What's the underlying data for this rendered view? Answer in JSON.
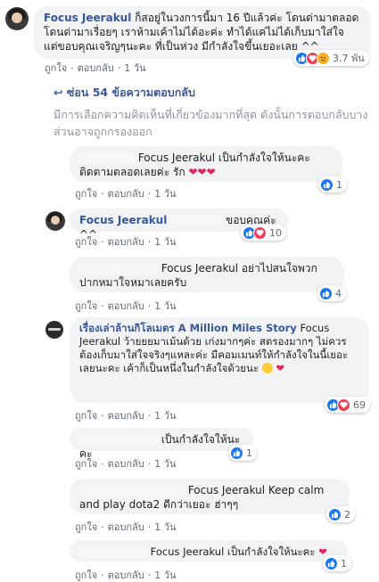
{
  "comments": [
    {
      "author": "Focus Jeerakul",
      "text": " ก็สอยู่ในวงการนี้มา 16 ปีแล้วค่ะ โดนด่ามาตลอด โดนด่ามาเรื่อยๆ เราห้ามเค้าไม่ได้อะค่ะ ทำได้แค่ไม่ได้เก็บมาใส่ใจ แต่ขอบคุณเจริญๆนะคะ ที่เป็นห่วง มีกำลังใจขึ้นเยอะเลย ^^",
      "like_label": "ถูกใจ",
      "reply_label": "ตอบกลับ",
      "time": "1 วัน",
      "reaction_count": "3.7 พัน"
    }
  ],
  "more_replies": "ซ่อน 54 ข้อความตอบกลับ",
  "relevance_notice": "มีการเลือกความคิดเห็นที่เกี่ยวข้องมากที่สุด ดังนั้นการตอบกลับบางส่วนอาจถูกกรองออก",
  "replies": [
    {
      "text": "Focus Jeerakul เป็นกำลังใจให้นะคะ ติดตามตลอดเลยค่ะ รัก",
      "like_label": "ถูกใจ",
      "reply_label": "ตอบกลับ",
      "time": "1 วัน",
      "reaction_count": "1"
    },
    {
      "author": "Focus Jeerakul",
      "text": "ขอบคุณค่ะ ^^",
      "like_label": "ถูกใจ",
      "reply_label": "ตอบกลับ",
      "time": "1 วัน",
      "reaction_count": "10"
    },
    {
      "text": "Focus Jeerakul อย่าไปสนใจพวกปากหมาใจหมาเลยครับ",
      "like_label": "ถูกใจ",
      "reply_label": "ตอบกลับ",
      "time": "1 วัน",
      "reaction_count": "4"
    },
    {
      "author": "เรื่องเล่าล้านกิโลเมตร A Million Miles Story",
      "tag": "Focus Jeerakul",
      "text": "ว้ายยยมาเม้นด้วย เก่งมากๆค่ะ สตรองมากๆ ไม่ควรต้องเก็บมาใส่ใจจริงๆแหละค่ะ มีคอมเมนท์ให้กำลังใจในนี้เยอะเลยนะคะ เค้าก็เป็นหนึ่งในกำลังใจด้วยนะ",
      "like_label": "ถูกใจ",
      "reply_label": "ตอบกลับ",
      "time": "1 วัน",
      "reaction_count": "69"
    },
    {
      "text": "เป็นกำลังใจให้นะคะ",
      "like_label": "ถูกใจ",
      "reply_label": "ตอบกลับ",
      "time": "1 วัน",
      "reaction_count": "1"
    },
    {
      "text": "Focus Jeerakul Keep calm and play dota2 ดีกว่าเยอะ ฮ่าๆๆ",
      "like_label": "ถูกใจ",
      "reply_label": "ตอบกลับ",
      "time": "1 วัน",
      "reaction_count": "2"
    },
    {
      "text": "Focus Jeerakul เป็นกำลังใจให้นะคะ",
      "like_label": "ถูกใจ",
      "reply_label": "ตอบกลับ",
      "time": "1 วัน",
      "reaction_count": "1"
    }
  ],
  "icons": [
    "like-icon",
    "love-icon",
    "sad-icon",
    "heart-emoji",
    "smile-emoji",
    "back-arrow-icon"
  ],
  "colors": {
    "link": "#385898",
    "bubble": "#f2f3f5",
    "like": "#1877f2",
    "love": "#f33e58",
    "meta": "#606770"
  }
}
